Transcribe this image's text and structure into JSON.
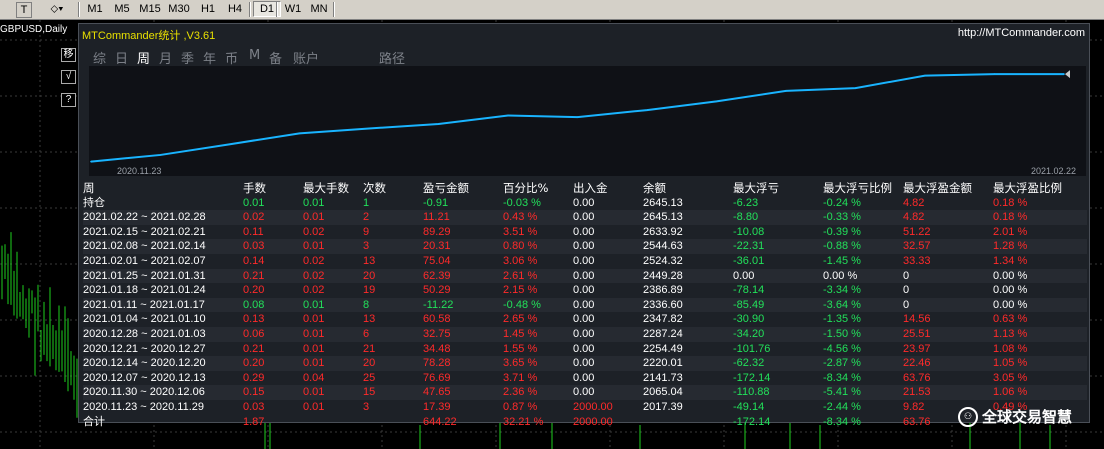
{
  "toolbar": {
    "icon1": "T",
    "icon2": "⬦▾",
    "timeframes": [
      "M1",
      "M5",
      "M15",
      "M30",
      "H1",
      "H4",
      "D1",
      "W1",
      "MN"
    ],
    "active": "D1"
  },
  "chart": {
    "symbol_label": "GBPUSD,Daily"
  },
  "side_buttons": [
    "移",
    "√",
    "?"
  ],
  "panel": {
    "title": "MTCommander统计 ,V3.61",
    "link": "http://MTCommander.com",
    "period_tabs": [
      "综",
      "日",
      "周",
      "月",
      "季",
      "年",
      "币",
      "M",
      "备",
      "账户",
      "路径"
    ],
    "active_tab": "周",
    "equity_start_date": "2020.11.23",
    "equity_end_date": "2021.02.22"
  },
  "chart_data": {
    "type": "line",
    "series": [
      {
        "values": [
          2017.39,
          2065.04,
          2141.73,
          2220.01,
          2254.49,
          2287.24,
          2347.82,
          2336.6,
          2386.89,
          2449.28,
          2524.32,
          2544.63,
          2633.92,
          2645.13,
          2645.13
        ]
      }
    ],
    "x": [
      "2020.11.23",
      "2020.11.30",
      "2020.12.07",
      "2020.12.14",
      "2020.12.21",
      "2020.12.28",
      "2021.01.04",
      "2021.01.11",
      "2021.01.18",
      "2021.01.25",
      "2021.02.01",
      "2021.02.08",
      "2021.02.15",
      "2021.02.22",
      "2021.02.26"
    ],
    "ylim": [
      2000,
      2660
    ],
    "line_color": "#19b4ff",
    "grid": false
  },
  "table": {
    "headers": [
      "周",
      "手数",
      "最大手数",
      "次数",
      "盈亏金额",
      "百分比%",
      "出入金",
      "余额",
      "最大浮亏",
      "最大浮亏比例",
      "最大浮盈金额",
      "最大浮盈比例"
    ],
    "rows": [
      {
        "cells": [
          "持仓",
          "0.01",
          "0.01",
          "1",
          "-0.91",
          "-0.03 %",
          "0.00",
          "2645.13",
          "-6.23",
          "-0.24 %",
          "4.82",
          "0.18 %"
        ],
        "tone": "g"
      },
      {
        "cells": [
          "2021.02.22 ~ 2021.02.28",
          "0.02",
          "0.01",
          "2",
          "11.21",
          "0.43 %",
          "0.00",
          "2645.13",
          "-8.80",
          "-0.33 %",
          "4.82",
          "0.18 %"
        ],
        "tone": "r"
      },
      {
        "cells": [
          "2021.02.15 ~ 2021.02.21",
          "0.11",
          "0.02",
          "9",
          "89.29",
          "3.51 %",
          "0.00",
          "2633.92",
          "-10.08",
          "-0.39 %",
          "51.22",
          "2.01 %"
        ],
        "tone": "r"
      },
      {
        "cells": [
          "2021.02.08 ~ 2021.02.14",
          "0.03",
          "0.01",
          "3",
          "20.31",
          "0.80 %",
          "0.00",
          "2544.63",
          "-22.31",
          "-0.88 %",
          "32.57",
          "1.28 %"
        ],
        "tone": "r"
      },
      {
        "cells": [
          "2021.02.01 ~ 2021.02.07",
          "0.14",
          "0.02",
          "13",
          "75.04",
          "3.06 %",
          "0.00",
          "2524.32",
          "-36.01",
          "-1.45 %",
          "33.33",
          "1.34 %"
        ],
        "tone": "r"
      },
      {
        "cells": [
          "2021.01.25 ~ 2021.01.31",
          "0.21",
          "0.02",
          "20",
          "62.39",
          "2.61 %",
          "0.00",
          "2449.28",
          "0.00",
          "0.00 %",
          "0",
          "0.00 %"
        ],
        "tone": "r"
      },
      {
        "cells": [
          "2021.01.18 ~ 2021.01.24",
          "0.20",
          "0.02",
          "19",
          "50.29",
          "2.15 %",
          "0.00",
          "2386.89",
          "-78.14",
          "-3.34 %",
          "0",
          "0.00 %"
        ],
        "tone": "r"
      },
      {
        "cells": [
          "2021.01.11 ~ 2021.01.17",
          "0.08",
          "0.01",
          "8",
          "-11.22",
          "-0.48 %",
          "0.00",
          "2336.60",
          "-85.49",
          "-3.64 %",
          "0",
          "0.00 %"
        ],
        "tone": "g"
      },
      {
        "cells": [
          "2021.01.04 ~ 2021.01.10",
          "0.13",
          "0.01",
          "13",
          "60.58",
          "2.65 %",
          "0.00",
          "2347.82",
          "-30.90",
          "-1.35 %",
          "14.56",
          "0.63 %"
        ],
        "tone": "r"
      },
      {
        "cells": [
          "2020.12.28 ~ 2021.01.03",
          "0.06",
          "0.01",
          "6",
          "32.75",
          "1.45 %",
          "0.00",
          "2287.24",
          "-34.20",
          "-1.50 %",
          "25.51",
          "1.13 %"
        ],
        "tone": "r"
      },
      {
        "cells": [
          "2020.12.21 ~ 2020.12.27",
          "0.21",
          "0.01",
          "21",
          "34.48",
          "1.55 %",
          "0.00",
          "2254.49",
          "-101.76",
          "-4.56 %",
          "23.97",
          "1.08 %"
        ],
        "tone": "r"
      },
      {
        "cells": [
          "2020.12.14 ~ 2020.12.20",
          "0.20",
          "0.01",
          "20",
          "78.28",
          "3.65 %",
          "0.00",
          "2220.01",
          "-62.32",
          "-2.87 %",
          "22.46",
          "1.05 %"
        ],
        "tone": "r"
      },
      {
        "cells": [
          "2020.12.07 ~ 2020.12.13",
          "0.29",
          "0.04",
          "25",
          "76.69",
          "3.71 %",
          "0.00",
          "2141.73",
          "-172.14",
          "-8.34 %",
          "63.76",
          "3.05 %"
        ],
        "tone": "r"
      },
      {
        "cells": [
          "2020.11.30 ~ 2020.12.06",
          "0.15",
          "0.01",
          "15",
          "47.65",
          "2.36 %",
          "0.00",
          "2065.04",
          "-110.88",
          "-5.41 %",
          "21.53",
          "1.06 %"
        ],
        "tone": "r"
      },
      {
        "cells": [
          "2020.11.23 ~ 2020.11.29",
          "0.03",
          "0.01",
          "3",
          "17.39",
          "0.87 %",
          "2000.00",
          "2017.39",
          "-49.14",
          "-2.44 %",
          "9.82",
          "0.49 %"
        ],
        "tone": "r"
      }
    ],
    "total": {
      "cells": [
        "合计",
        "1.87",
        "",
        "",
        "644.22",
        "32.21 %",
        "2000.00",
        "",
        "-172.14",
        "-8.34 %",
        "63.76",
        ""
      ]
    }
  },
  "watermark": "全球交易智慧",
  "colors": {
    "panel_bg": "#1d2127",
    "positive": "#ff2a2a",
    "negative": "#22e05a",
    "title": "#e8e000"
  }
}
